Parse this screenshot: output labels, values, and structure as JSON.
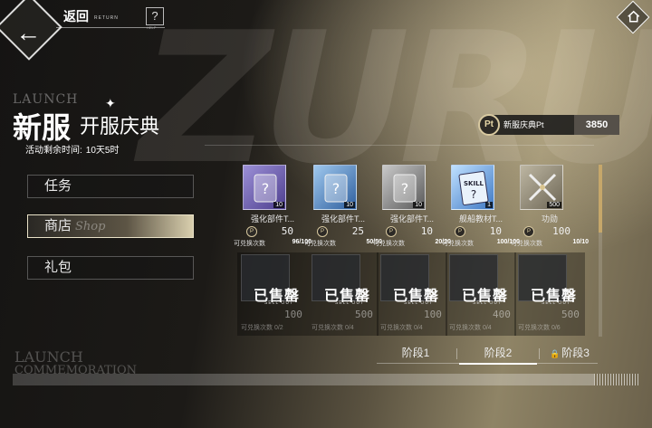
{
  "topbar": {
    "back_label": "返回",
    "back_sub": "RETURN",
    "help_label": "?",
    "help_sub": "HELP"
  },
  "watermark": "ZURU",
  "event": {
    "title_en": "LAUNCH",
    "title_main": "新服",
    "title_sub": "开服庆典",
    "timer_label": "活动剩余时间:",
    "timer_value": "10天5时"
  },
  "menu": {
    "items": [
      {
        "label": "任务",
        "en": ""
      },
      {
        "label": "商店",
        "en": "Shop"
      },
      {
        "label": "礼包",
        "en": ""
      }
    ],
    "active_index": 1
  },
  "footer_text": {
    "line1": "LAUNCH",
    "line2": "COMMEMORATION"
  },
  "points": {
    "icon_text": "Pt",
    "label": "新服庆典Pt",
    "value": "3850"
  },
  "shop": {
    "limit_label": "可兑换次数",
    "items": [
      {
        "name": "强化部件T...",
        "qty": "10",
        "cost": "50",
        "limit": "96/100",
        "icon": "purple-card-icon",
        "color": "#6a5aa6"
      },
      {
        "name": "强化部件T...",
        "qty": "10",
        "cost": "25",
        "limit": "50/50",
        "icon": "blue-card-icon",
        "color": "#4d7fb8"
      },
      {
        "name": "强化部件T...",
        "qty": "10",
        "cost": "10",
        "limit": "20/20",
        "icon": "grey-card-icon",
        "color": "#8b8b8b"
      },
      {
        "name": "舰船教材T...",
        "qty": "1",
        "cost": "10",
        "limit": "100/100",
        "icon": "skill-book-icon",
        "color": "#5a8fd0"
      },
      {
        "name": "功勋",
        "qty": "500",
        "cost": "100",
        "limit": "10/10",
        "icon": "crossed-swords-icon",
        "color": "#8a8270"
      }
    ],
    "sold_items": [
      {
        "sold_label": "已售罄",
        "sold_sub": "SELL OUT",
        "cost": "100",
        "limit": "可兑换次数 0/2"
      },
      {
        "sold_label": "已售罄",
        "sold_sub": "SELL OUT",
        "cost": "500",
        "limit": "可兑换次数 0/4"
      },
      {
        "sold_label": "已售罄",
        "sold_sub": "SELL OUT",
        "cost": "100",
        "limit": "可兑换次数 0/4"
      },
      {
        "sold_label": "已售罄",
        "sold_sub": "SELL OUT",
        "cost": "400",
        "limit": "可兑换次数 0/4"
      },
      {
        "sold_label": "已售罄",
        "sold_sub": "SELL OUT",
        "cost": "500",
        "limit": "可兑换次数 0/6"
      }
    ]
  },
  "stages": [
    {
      "label": "阶段1",
      "locked": false
    },
    {
      "label": "阶段2",
      "locked": false
    },
    {
      "label": "阶段3",
      "locked": true
    }
  ],
  "active_stage": 1
}
